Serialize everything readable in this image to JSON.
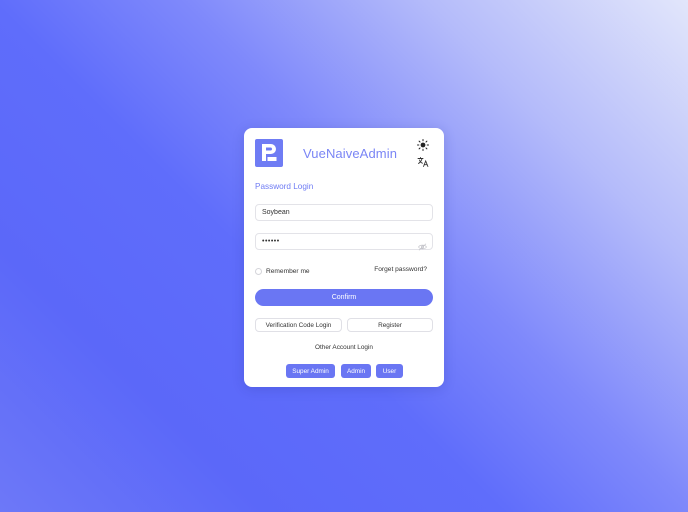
{
  "header": {
    "logo_icon": "brand-logo-icon",
    "title": "VueNaiveAdmin",
    "theme_icon": "sun-icon",
    "language_icon": "translate-icon"
  },
  "form": {
    "section_title": "Password Login",
    "username": {
      "value": "Soybean",
      "placeholder": ""
    },
    "password": {
      "value": "123456",
      "masked": true,
      "toggle_icon": "eye-icon"
    },
    "remember_me_label": "Remember me",
    "remember_me_checked": false,
    "forget_password_label": "Forget password?",
    "confirm_label": "Confirm",
    "code_login_label": "Verification Code Login",
    "register_label": "Register"
  },
  "other_accounts": {
    "title": "Other Account Login",
    "buttons": [
      "Super Admin",
      "Admin",
      "User"
    ]
  },
  "colors": {
    "primary": "#6a76f3",
    "title": "#7a85f5",
    "background_start": "#5b68f9",
    "background_end": "#e2e6fb"
  }
}
